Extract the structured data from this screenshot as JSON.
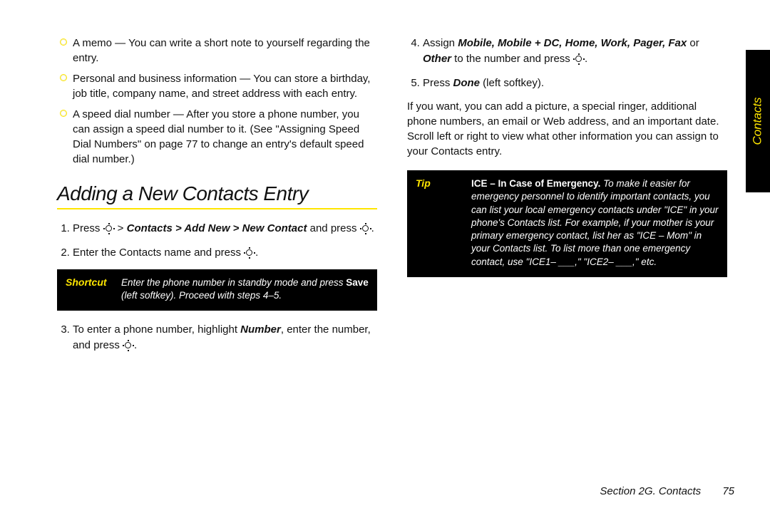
{
  "side_tab": "Contacts",
  "bullets": [
    "A memo — You can write a short note to yourself regarding the entry.",
    "Personal and business information — You can store a birthday, job title, company name, and street address with each entry.",
    "A speed dial number — After you store a phone number, you can assign a speed dial number to it. (See \"Assigning Speed Dial Numbers\" on page 77 to change an entry's default speed dial number.)"
  ],
  "heading": "Adding a New Contacts Entry",
  "steps_left": {
    "s1_a": "Press ",
    "s1_b": " > ",
    "s1_path": "Contacts > Add New > New Contact",
    "s1_c": " and press ",
    "s1_d": ".",
    "s2_a": "Enter the Contacts name and press ",
    "s2_b": ".",
    "s3_a": "To enter a phone number, highlight ",
    "s3_num": "Number",
    "s3_b": ", enter the number, and press ",
    "s3_c": "."
  },
  "shortcut": {
    "tag": "Shortcut",
    "a": "Enter the phone number in standby mode and press ",
    "save": "Save",
    "b": " (left softkey). Proceed with steps 4–5."
  },
  "steps_right": {
    "s4_a": "Assign ",
    "s4_opts": "Mobile, Mobile + DC, Home, Work, Pager, Fax",
    "s4_b": " or ",
    "s4_other": "Other",
    "s4_c": " to the number and press ",
    "s4_d": ".",
    "s5_a": "Press ",
    "s5_done": "Done",
    "s5_b": " (left softkey)."
  },
  "para_right": "If you want, you can add a picture, a special ringer, additional phone numbers, an email or Web address, and an important date. Scroll left or right to view what other information you can assign to your Contacts entry.",
  "tip": {
    "tag": "Tip",
    "lead": "ICE – In Case of Emergency.",
    "body": " To make it easier for emergency personnel to identify important contacts, you can list your local emergency contacts under \"ICE\" in your phone's Contacts list. For example, if your mother is your primary emergency contact, list her as \"ICE – Mom\" in your Contacts list. To list more than one emergency contact, use \"ICE1– ___,\" \"ICE2– ___,\" etc."
  },
  "footer": {
    "section": "Section 2G. Contacts",
    "page": "75"
  }
}
